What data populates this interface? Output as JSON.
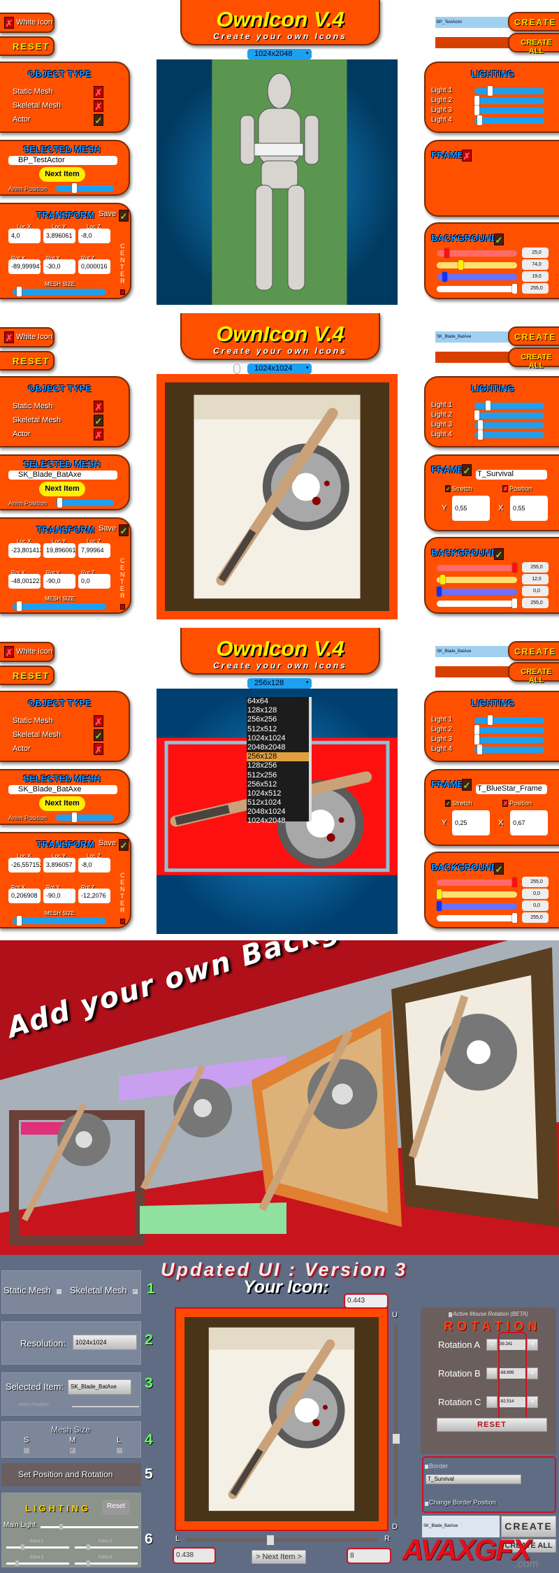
{
  "labels": {
    "app_title": "OwnIcon V.4",
    "app_subtitle": "Create your own Icons",
    "white_icon": "White Icon",
    "reset": "RESET",
    "object_type": "OBJECT TYPE",
    "static_mesh": "Static Mesh",
    "skeletal_mesh": "Skeletal Mesh",
    "actor": "Actor",
    "selected_mesh": "SELECTED MESH",
    "next_item": "Next Item",
    "anim_position": "Anim Position",
    "transform": "TRANSFORM",
    "save": "Save",
    "loc": [
      "Loc X",
      "Loc Y",
      "Loc Z"
    ],
    "rot": [
      "Rot X",
      "Rot Y",
      "Rot Z"
    ],
    "mesh_size": "MESH SIZE",
    "center": "CENTER",
    "lighting": "LIGHTING",
    "lights": [
      "Light 1",
      "Light 2",
      "Light 3",
      "Light 4"
    ],
    "frame": "FRAME",
    "stretch": "Stretch",
    "position": "Position",
    "y": "Y",
    "x": "X",
    "background": "BACKGROUND",
    "create": "CREATE",
    "create_all": "CREATE ALL"
  },
  "colors": {
    "panel": "#ff5000",
    "panel_title": "#1a9cff",
    "title": "#ffef00",
    "dropdown": "#1ea0f0"
  },
  "screens": [
    {
      "resolution": "1024x2048",
      "white_icon_checked": false,
      "object_type": {
        "static_mesh": false,
        "skeletal_mesh": false,
        "actor": true
      },
      "selected_mesh": "BP_TestActor",
      "anim_position": 0.3,
      "transform": {
        "save": true,
        "loc": [
          "4,0",
          "3,896061",
          "-8,0"
        ],
        "rot": [
          "-89,999947",
          "-30,0",
          "0,000016"
        ]
      },
      "mesh_size": 0.05,
      "export_name": "BP_TestActor",
      "lights": [
        0.2,
        0.0,
        0.0,
        0.04
      ],
      "frame": {
        "enabled": false
      },
      "background": {
        "enabled": true,
        "values": [
          25,
          74,
          19,
          255
        ],
        "labels": [
          "25,0",
          "74,0",
          "19,0",
          "255,0"
        ]
      },
      "viewport": "robot",
      "mouse_icon": false
    },
    {
      "resolution": "1024x1024",
      "white_icon_checked": false,
      "object_type": {
        "static_mesh": false,
        "skeletal_mesh": true,
        "actor": false
      },
      "selected_mesh": "SK_Blade_BatAxe",
      "anim_position": 0.02,
      "transform": {
        "save": true,
        "loc": [
          "-23,801413",
          "19,896061",
          "7,99964"
        ],
        "rot": [
          "-48,001221",
          "-90,0",
          "0,0"
        ]
      },
      "mesh_size": 0.05,
      "export_name": "SK_Blade_BatAxe",
      "lights": [
        0.17,
        0.0,
        0.05,
        0.05
      ],
      "frame": {
        "enabled": true,
        "texture": "T_Survival",
        "stretch": true,
        "position": false,
        "y": "0,55",
        "x": "0,55"
      },
      "background": {
        "enabled": true,
        "values": [
          255,
          12,
          0,
          255
        ],
        "labels": [
          "255,0",
          "12,0",
          "0,0",
          "255,0"
        ]
      },
      "viewport": "survival",
      "mouse_icon": true
    },
    {
      "resolution": "256x128",
      "white_icon_checked": false,
      "object_type": {
        "static_mesh": false,
        "skeletal_mesh": true,
        "actor": false
      },
      "selected_mesh": "SK_Blade_BatAxe",
      "anim_position": 0.3,
      "transform": {
        "save": true,
        "loc": [
          "-26,557152",
          "3,896057",
          "-8,0"
        ],
        "rot": [
          "0,206908",
          "-90,0",
          "-12,2076"
        ]
      },
      "mesh_size": 0.05,
      "export_name": "SK_Blade_BatAxe",
      "lights": [
        0.2,
        0.0,
        0.0,
        0.04
      ],
      "frame": {
        "enabled": true,
        "texture": "T_BlueStar_Frame",
        "stretch": true,
        "position": false,
        "y": "0,25",
        "x": "0,67"
      },
      "background": {
        "enabled": true,
        "values": [
          255,
          0,
          0,
          255
        ],
        "labels": [
          "255,0",
          "0,0",
          "0,0",
          "255,0"
        ]
      },
      "viewport": "bluestar",
      "mouse_icon": false,
      "resolution_options": [
        "64x64",
        "128x128",
        "256x256",
        "512x512",
        "1024x1024",
        "2048x2048",
        "256x128",
        "128x256",
        "512x256",
        "256x512",
        "1024x512",
        "512x1024",
        "2048x1024",
        "1024x2048"
      ]
    }
  ],
  "banner": {
    "text": "Add your own Background"
  },
  "v3": {
    "title": "Updated UI : Version 3",
    "your_icon": "Your Icon:",
    "scale_value": "0.443",
    "static_mesh": "Static Mesh",
    "skeletal_mesh": "Skeletal Mesh",
    "static_checked": false,
    "skeletal_checked": true,
    "steps": [
      "1",
      "2",
      "3",
      "4",
      "5",
      "6"
    ],
    "resolution_label": "Resolution:",
    "resolution": "1024x1024",
    "selected_item_label": "Selected Item:",
    "selected_item": "SK_Blade_BatAxe",
    "anim_position": "Anim Position",
    "mesh_size": "Mesh Size",
    "sizes": [
      "S",
      "M",
      "L"
    ],
    "size_selected": "M",
    "set_position": "Set Position and Rotation",
    "lighting": "LIGHTING",
    "lighting_reset": "Reset",
    "main_light": "Main Light",
    "extras": [
      "Extra 1",
      "Extra 2",
      "Extra 3",
      "Extra 4"
    ],
    "main_light_level": 0.2,
    "extra_levels": [
      0.25,
      0.2,
      0.15,
      0.2
    ],
    "up": "U",
    "down": "D",
    "left": "L",
    "right": "R",
    "vertical_level": 0.6,
    "horizontal_level": 0.44,
    "left_value": "0.438",
    "next_item": "> Next Item >",
    "right_value": "8",
    "active_mouse_rotation": "Active Mouse Rotation (BETA)",
    "rotation_title": "ROTATION",
    "rotations": [
      {
        "label": "Rotation A",
        "value": "39.241"
      },
      {
        "label": "Rotation B",
        "value": "-68.699"
      },
      {
        "label": "Rotation C",
        "value": "-82.514"
      }
    ],
    "minus": "-",
    "plus": "+",
    "reset": "RESET",
    "border_label": "Border",
    "border_texture": "T_Survival",
    "change_border_position": "Change Border Position",
    "export_name": "SK_Blade_BatAxe",
    "create": "CREATE",
    "create_all": "CREATE ALL",
    "watermark": "AVAXGFX",
    "watermark_suffix": ".com"
  }
}
